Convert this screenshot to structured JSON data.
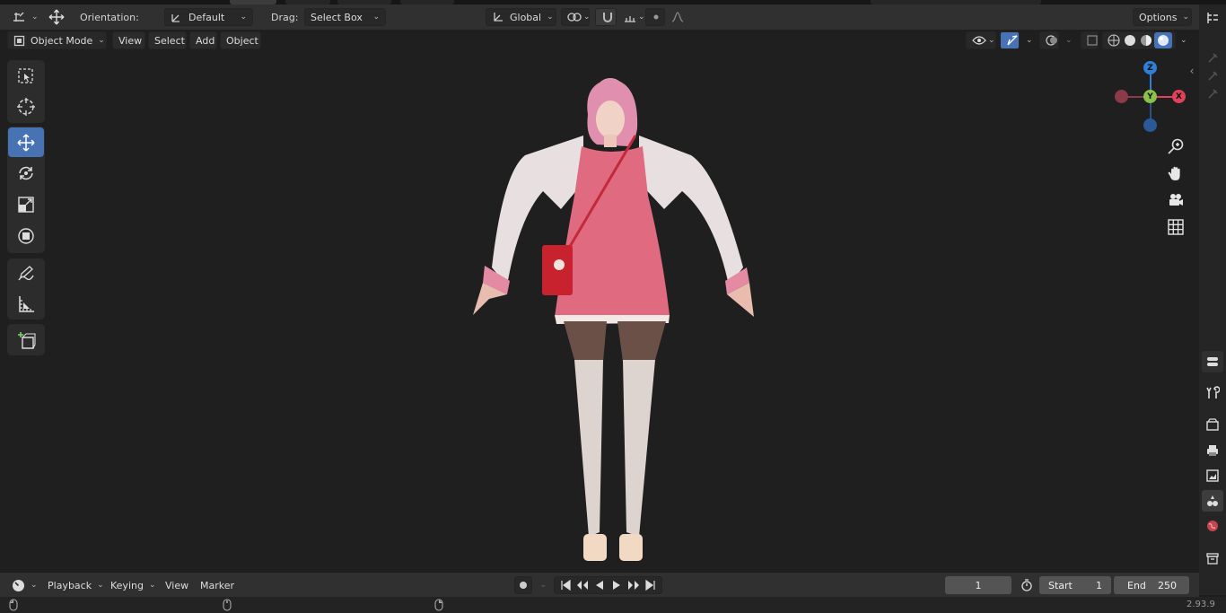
{
  "header": {
    "orientation_label": "Orientation:",
    "orientation_value": "Default",
    "drag_label": "Drag:",
    "drag_value": "Select Box",
    "transform_orientation": "Global",
    "options_label": "Options"
  },
  "viewport_header": {
    "mode": "Object Mode",
    "menus": [
      "View",
      "Select",
      "Add",
      "Object"
    ]
  },
  "gizmo": {
    "axes": [
      {
        "label": "Z",
        "color": "#2f7fd6"
      },
      {
        "label": "Y",
        "color": "#8bc34a"
      },
      {
        "label": "X",
        "color": "#e0425a"
      }
    ]
  },
  "toolbar": {
    "tools": [
      "select-box-icon",
      "cursor-icon",
      "move-icon",
      "rotate-icon",
      "scale-icon",
      "transform-icon",
      "annotate-icon",
      "measure-icon",
      "add-cube-icon"
    ],
    "active": "move-icon"
  },
  "timeline": {
    "menus": [
      "Playback",
      "Keying",
      "View",
      "Marker"
    ],
    "current_frame": "1",
    "start_label": "Start",
    "start_value": "1",
    "end_label": "End",
    "end_value": "250"
  },
  "status": {
    "version": "2.93.9"
  },
  "colors": {
    "active_blue": "#4772b3",
    "header_bg": "#303030",
    "viewport_bg": "#1f1f1f"
  }
}
